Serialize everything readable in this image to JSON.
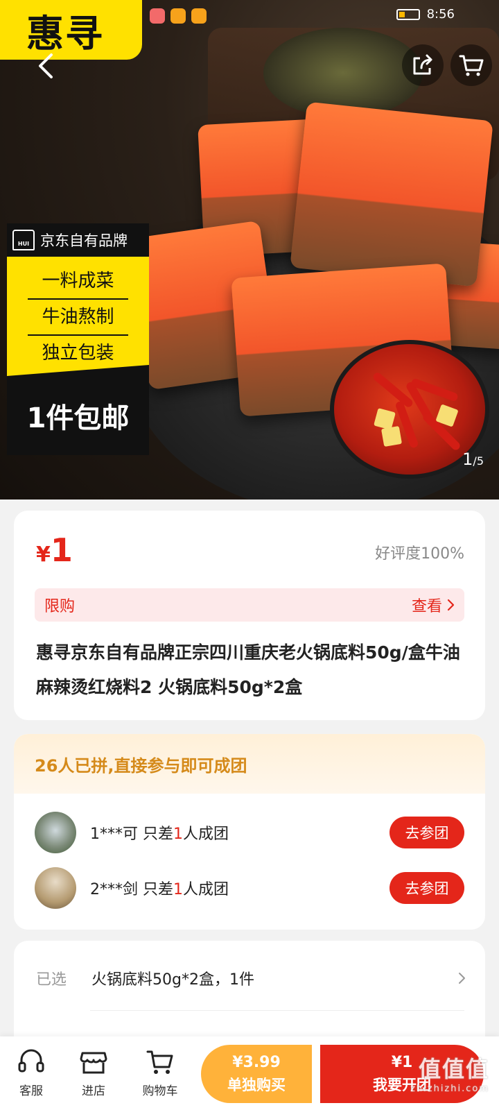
{
  "brand_logo": "惠寻",
  "status_bar": {
    "time": "8:56"
  },
  "colors": {
    "accent_red": "#e4261a",
    "accent_yellow": "#ffe100",
    "solo_orange": "#ffb23a"
  },
  "gallery": {
    "promo": {
      "brand_label": "京东自有品牌",
      "brand_icon_text": "HUI",
      "features": [
        "一料成菜",
        "牛油熬制",
        "独立包装"
      ],
      "shipping": "1件包邮"
    },
    "indicator_current": "1",
    "indicator_total": "/5"
  },
  "product": {
    "currency": "¥",
    "price": "1",
    "rating": "好评度100%",
    "limit_label": "限购",
    "limit_action": "查看",
    "title": "惠寻京东自有品牌正宗四川重庆老火锅底料50g/盒牛油麻辣烫红烧料2 火锅底料50g*2盒"
  },
  "group_buy": {
    "header": "26人已拼,直接参与即可成团",
    "groups": [
      {
        "user": "1***可",
        "pre": "只差",
        "count": "1",
        "post": "人成团",
        "action": "去参团"
      },
      {
        "user": "2***剑",
        "pre": "只差",
        "count": "1",
        "post": "人成团",
        "action": "去参团"
      }
    ]
  },
  "selection": {
    "label": "已选",
    "value": "火锅底料50g*2盒，1件"
  },
  "bottom_bar": {
    "service": "客服",
    "store": "进店",
    "cart": "购物车",
    "solo_price": "¥3.99",
    "solo_label": "单独购买",
    "group_price": "¥1",
    "group_label": "我要开团"
  },
  "watermark": {
    "mark": "值值值",
    "site": "zhizhizhi.com"
  }
}
